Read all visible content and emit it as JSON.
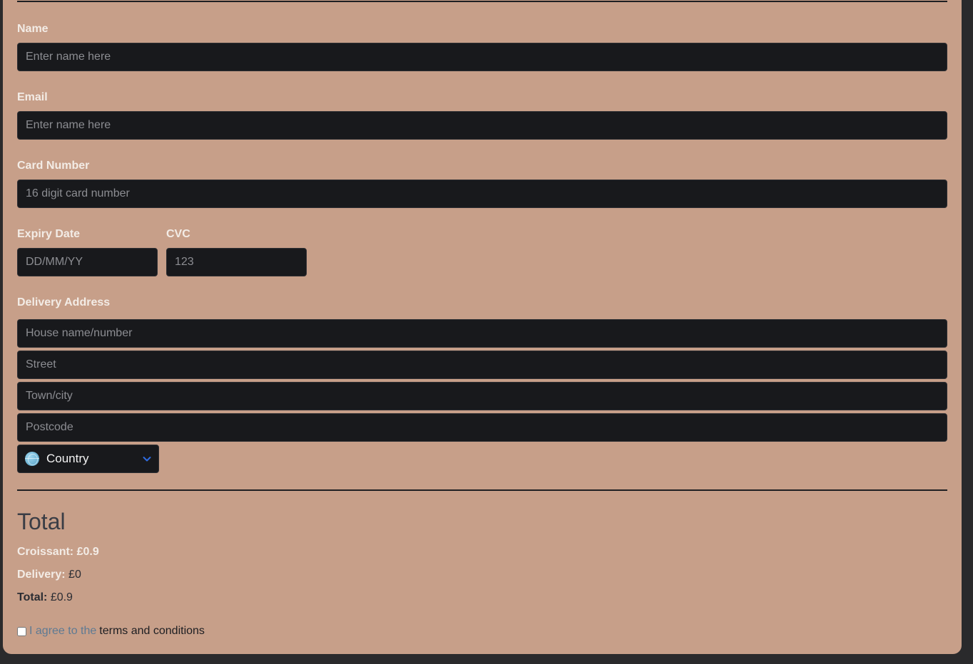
{
  "form": {
    "name_label": "Name",
    "name_placeholder": "Enter name here",
    "email_label": "Email",
    "email_placeholder": "Enter name here",
    "card_label": "Card Number",
    "card_placeholder": "16 digit card number",
    "expiry_label": "Expiry Date",
    "expiry_placeholder": "DD/MM/YY",
    "cvc_label": "CVC",
    "cvc_placeholder": "123",
    "address_label": "Delivery Address",
    "house_placeholder": "House name/number",
    "street_placeholder": "Street",
    "town_placeholder": "Town/city",
    "postcode_placeholder": "Postcode",
    "country_label": "Country"
  },
  "summary": {
    "title": "Total",
    "item_label": "Croissant:",
    "item_value": "£0.9",
    "delivery_label": "Delivery:",
    "delivery_value": "£0",
    "total_label": "Total:",
    "total_value": "£0.9"
  },
  "terms": {
    "prefix": "I agree to the",
    "link": "terms and conditions"
  },
  "colors": {
    "panel": "#c79f89",
    "field": "#18191c",
    "chevron": "#2f6be0"
  }
}
